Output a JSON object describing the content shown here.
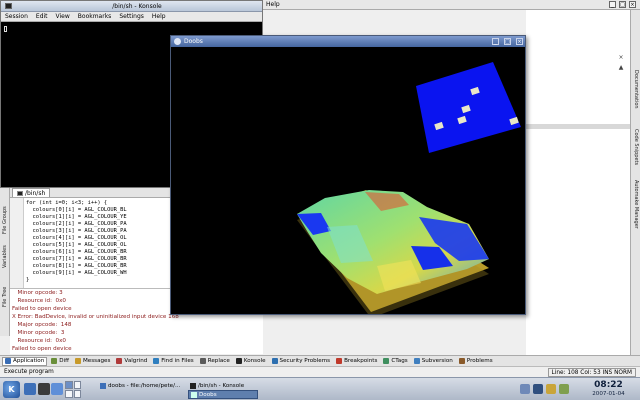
{
  "konsole": {
    "title": "/bin/sh - Konsole",
    "menu": [
      "Session",
      "Edit",
      "View",
      "Bookmarks",
      "Settings",
      "Help"
    ]
  },
  "kdevelop": {
    "menu_help": "Help",
    "side_tabs": [
      "Documentation",
      "Code Snippets",
      "Automake Manager"
    ],
    "left_tabs": [
      "File Groups",
      "Variables",
      "File Tree"
    ],
    "editor_tab": "/bin/sh",
    "code_lines": [
      "for (int i=0; i<3; i++) {",
      "  colours[0][i] = AGL_COLOUR_BL",
      "  colours[1][i] = AGL_COLOUR_YE",
      "  colours[2][i] = AGL_COLOUR_PA",
      "  colours[3][i] = AGL_COLOUR_PA",
      "  colours[4][i] = AGL_COLOUR_OL",
      "  colours[5][i] = AGL_COLOUR_OL",
      "  colours[6][i] = AGL_COLOUR_BR",
      "  colours[7][i] = AGL_COLOUR_BR",
      "  colours[8][i] = AGL_COLOUR_BR",
      "  colours[9][i] = AGL_COLOUR_WH",
      "}"
    ],
    "output_lines": [
      {
        "text": "  Minor opcode: 3",
        "color": "#8b1a1a"
      },
      {
        "text": "  Resource id:  0x0",
        "color": "#8b1a1a"
      },
      {
        "text": "Failed to open device",
        "color": "#8b1a1a"
      },
      {
        "text": "X Error: BadDevice, invalid or uninitialized input device 168",
        "color": "#8b1a1a"
      },
      {
        "text": "  Major opcode:  148",
        "color": "#8b1a1a"
      },
      {
        "text": "  Minor opcode:  3",
        "color": "#8b1a1a"
      },
      {
        "text": "  Resource id:  0x0",
        "color": "#8b1a1a"
      },
      {
        "text": "Failed to open device",
        "color": "#8b1a1a"
      }
    ],
    "bottom_tabs": [
      {
        "label": "Application",
        "icon_color": "#3a6db5",
        "active": true
      },
      {
        "label": "Diff",
        "icon_color": "#6a8f3a",
        "active": false
      },
      {
        "label": "Messages",
        "icon_color": "#c89a2a",
        "active": false
      },
      {
        "label": "Valgrind",
        "icon_color": "#b03a3a",
        "active": false
      },
      {
        "label": "Find in Files",
        "icon_color": "#2f7fbf",
        "active": false
      },
      {
        "label": "Replace",
        "icon_color": "#5a5a5a",
        "active": false
      },
      {
        "label": "Konsole",
        "icon_color": "#222222",
        "active": false
      },
      {
        "label": "Security Problems",
        "icon_color": "#2d6fb0",
        "active": false
      },
      {
        "label": "Breakpoints",
        "icon_color": "#c0392b",
        "active": false
      },
      {
        "label": "CTags",
        "icon_color": "#3f8f5f",
        "active": false
      },
      {
        "label": "Subversion",
        "icon_color": "#3f7fbf",
        "active": false
      },
      {
        "label": "Problems",
        "icon_color": "#8a5a2a",
        "active": false
      }
    ],
    "status_message": "Execute program",
    "status_position": "Line: 108 Col: 53  INS  NORM"
  },
  "doobs": {
    "title": "Doobs"
  },
  "taskbar": {
    "tasks": [
      {
        "label": "doobs - file:/home/pete/...",
        "active": false
      },
      {
        "label": "/bin/sh - Konsole",
        "active": false
      },
      {
        "label": "Doobs",
        "active": true
      }
    ],
    "time": "08:22",
    "date": "2007-01-04"
  }
}
